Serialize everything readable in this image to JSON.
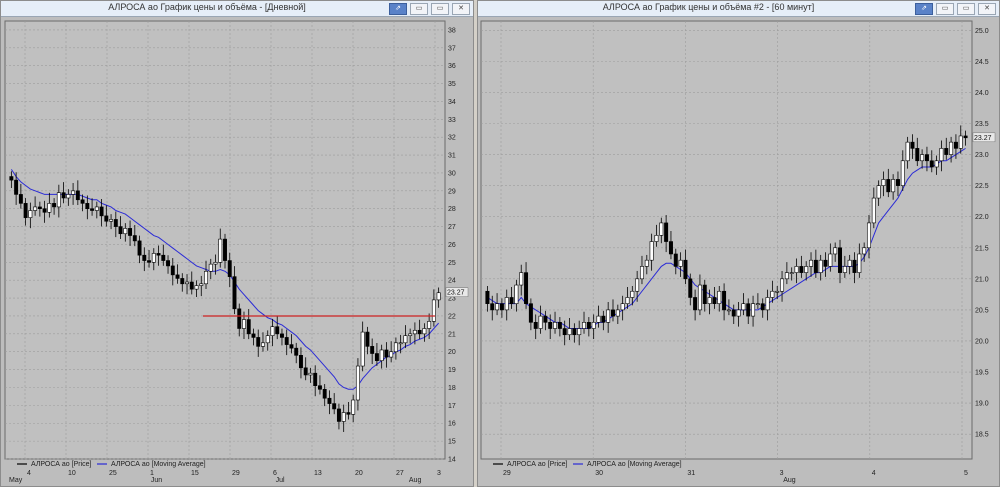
{
  "windows": {
    "left": {
      "title": "АЛРОСА ао График цены и объёма - [Дневной]",
      "buttons": [
        "⇗",
        "▭",
        "▭",
        "✕"
      ]
    },
    "right": {
      "title": "АЛРОСА ао График цены и объёма #2 - [60 минут]",
      "buttons": [
        "⇗",
        "▭",
        "▭",
        "✕"
      ]
    }
  },
  "colors": {
    "plot_bg": "#c0c0c0",
    "grid": "#9c9c9c",
    "candle": "#000000",
    "ma": "#2b2bd6",
    "hline": "#cc2222"
  },
  "chart_data": [
    {
      "type": "candlestick",
      "ylim": [
        14,
        38.5
      ],
      "yticks": [
        14,
        15,
        16,
        17,
        18,
        19,
        20,
        21,
        22,
        23,
        24,
        25,
        26,
        27,
        28,
        29,
        30,
        31,
        32,
        33,
        34,
        35,
        36,
        37,
        38
      ],
      "last_value_label": "23.27",
      "x_day_labels": [
        "4",
        "10",
        "25",
        "1",
        "15",
        "29",
        "6",
        "13",
        "20",
        "27",
        "3"
      ],
      "x_month_labels": [
        "May",
        "Jun",
        "Jul",
        "Aug"
      ],
      "hline": 22,
      "legend": [
        "АЛРОСА ао [Price]",
        "АЛРОСА ао [Moving Average]"
      ],
      "close": [
        29.6,
        28.8,
        28.3,
        27.5,
        27.9,
        28.1,
        28.0,
        27.8,
        28.3,
        28.1,
        28.9,
        28.6,
        28.8,
        29.0,
        28.5,
        28.3,
        28.0,
        27.9,
        28.1,
        27.6,
        27.3,
        27.4,
        27.0,
        26.6,
        26.9,
        26.5,
        26.2,
        25.4,
        25.1,
        25.0,
        25.5,
        25.4,
        25.1,
        24.8,
        24.3,
        24.1,
        23.8,
        23.9,
        23.5,
        23.7,
        23.8,
        24.5,
        24.9,
        25.0,
        26.3,
        25.1,
        24.2,
        22.4,
        21.3,
        21.8,
        21.0,
        20.8,
        20.3,
        20.5,
        20.9,
        21.4,
        21.0,
        20.8,
        20.4,
        20.2,
        19.8,
        19.1,
        18.7,
        18.8,
        18.1,
        17.9,
        17.4,
        17.1,
        16.8,
        16.1,
        16.6,
        16.5,
        17.3,
        19.2,
        21.1,
        20.3,
        19.9,
        19.5,
        20.1,
        19.7,
        20.0,
        20.5,
        20.5,
        20.9,
        21.0,
        21.2,
        21.0,
        21.3,
        21.7,
        22.9,
        23.3
      ],
      "ma": [
        30.2,
        29.8,
        29.5,
        29.3,
        29.1,
        29.0,
        28.9,
        28.8,
        28.8,
        28.8,
        28.8,
        28.8,
        28.8,
        28.8,
        28.8,
        28.7,
        28.6,
        28.5,
        28.5,
        28.3,
        28.2,
        28.1,
        27.9,
        27.8,
        27.7,
        27.5,
        27.3,
        27.1,
        26.9,
        26.7,
        26.5,
        26.4,
        26.2,
        26.0,
        25.8,
        25.6,
        25.4,
        25.2,
        25.0,
        24.8,
        24.7,
        24.6,
        24.5,
        24.5,
        24.6,
        24.5,
        24.3,
        23.9,
        23.5,
        23.2,
        22.9,
        22.6,
        22.3,
        22.1,
        21.9,
        21.8,
        21.6,
        21.5,
        21.3,
        21.1,
        20.9,
        20.6,
        20.3,
        20.1,
        19.8,
        19.5,
        19.2,
        18.9,
        18.6,
        18.2,
        18.0,
        17.9,
        17.9,
        18.1,
        18.5,
        18.8,
        19.1,
        19.3,
        19.5,
        19.7,
        19.8,
        20.0,
        20.1,
        20.3,
        20.4,
        20.6,
        20.7,
        20.8,
        21.0,
        21.3,
        21.6
      ]
    },
    {
      "type": "candlestick",
      "ylim": [
        18.1,
        25.15
      ],
      "yticks": [
        18.5,
        19.0,
        19.5,
        20.0,
        20.5,
        21.0,
        21.5,
        22.0,
        22.5,
        23.0,
        23.5,
        24.0,
        24.5,
        25.0
      ],
      "last_value_label": "23.27",
      "x_day_labels": [
        "29",
        "30",
        "31",
        "3",
        "4",
        "5"
      ],
      "x_month_labels": [
        "Aug"
      ],
      "legend": [
        "АЛРОСА ао [Price]",
        "АЛРОСА ао [Moving Average]"
      ],
      "close": [
        20.6,
        20.5,
        20.6,
        20.5,
        20.7,
        20.6,
        20.9,
        21.1,
        20.6,
        20.3,
        20.2,
        20.4,
        20.3,
        20.2,
        20.3,
        20.2,
        20.1,
        20.2,
        20.1,
        20.2,
        20.3,
        20.2,
        20.3,
        20.4,
        20.3,
        20.5,
        20.4,
        20.5,
        20.6,
        20.7,
        20.8,
        21.0,
        21.2,
        21.3,
        21.6,
        21.7,
        21.9,
        21.6,
        21.4,
        21.2,
        21.3,
        21.0,
        20.7,
        20.5,
        20.9,
        20.6,
        20.7,
        20.6,
        20.8,
        20.5,
        20.5,
        20.4,
        20.5,
        20.6,
        20.4,
        20.6,
        20.6,
        20.5,
        20.7,
        20.8,
        20.8,
        21.0,
        21.1,
        21.1,
        21.2,
        21.1,
        21.2,
        21.3,
        21.1,
        21.3,
        21.2,
        21.4,
        21.5,
        21.1,
        21.2,
        21.3,
        21.1,
        21.4,
        21.5,
        21.9,
        22.3,
        22.5,
        22.6,
        22.4,
        22.6,
        22.5,
        22.9,
        23.2,
        23.1,
        22.9,
        23.0,
        22.9,
        22.8,
        22.9,
        23.1,
        23.0,
        23.2,
        23.1,
        23.3,
        23.27
      ],
      "ma": [
        20.7,
        20.65,
        20.6,
        20.6,
        20.6,
        20.6,
        20.6,
        20.7,
        20.6,
        20.55,
        20.5,
        20.45,
        20.4,
        20.35,
        20.3,
        20.3,
        20.25,
        20.2,
        20.2,
        20.2,
        20.2,
        20.2,
        20.25,
        20.3,
        20.3,
        20.35,
        20.4,
        20.45,
        20.5,
        20.55,
        20.6,
        20.7,
        20.8,
        20.9,
        21.0,
        21.1,
        21.2,
        21.25,
        21.25,
        21.2,
        21.15,
        21.1,
        21.0,
        20.9,
        20.85,
        20.8,
        20.75,
        20.7,
        20.65,
        20.6,
        20.55,
        20.5,
        20.5,
        20.5,
        20.5,
        20.5,
        20.5,
        20.55,
        20.6,
        20.65,
        20.7,
        20.75,
        20.8,
        20.85,
        20.9,
        20.95,
        21.0,
        21.05,
        21.1,
        21.1,
        21.15,
        21.2,
        21.2,
        21.2,
        21.2,
        21.2,
        21.2,
        21.25,
        21.35,
        21.5,
        21.7,
        21.9,
        22.0,
        22.1,
        22.2,
        22.3,
        22.45,
        22.6,
        22.7,
        22.75,
        22.8,
        22.8,
        22.8,
        22.85,
        22.9,
        22.9,
        22.95,
        23.0,
        23.05,
        23.1
      ]
    }
  ]
}
